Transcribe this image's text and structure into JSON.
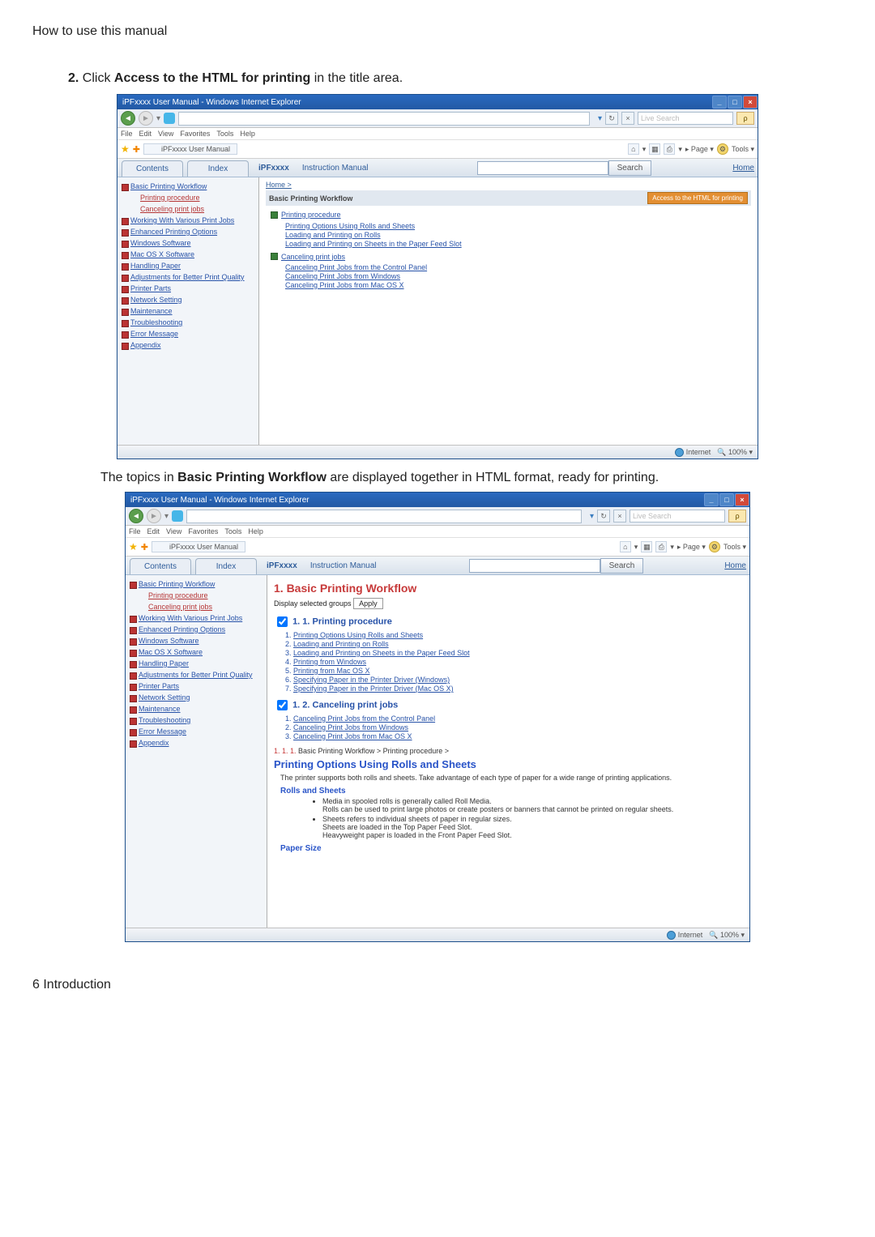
{
  "doc": {
    "breadcrumb_top": "How to use this manual",
    "step_num": "2.",
    "step_prefix": "Click ",
    "step_bold": "Access to the HTML for printing",
    "step_suffix": " in the title area.",
    "caption2_a": "The topics in ",
    "caption2_b": "Basic Printing Workflow",
    "caption2_c": " are displayed together in HTML format, ready for printing.",
    "footer": "6 Introduction"
  },
  "win": {
    "title": "iPFxxxx User Manual - Windows Internet Explorer",
    "search_placeholder": "Live Search",
    "menu": [
      "File",
      "Edit",
      "View",
      "Favorites",
      "Tools",
      "Help"
    ],
    "tab_label": "iPFxxxx User Manual",
    "tool_page": "Page",
    "tool_tools": "Tools"
  },
  "manual": {
    "tabs": {
      "contents": "Contents",
      "index": "Index"
    },
    "brand": "iPFxxxx",
    "doc_type": "Instruction Manual",
    "search_btn": "Search",
    "home": "Home",
    "nav": [
      {
        "t": "Basic Printing Workflow",
        "cls": "top"
      },
      {
        "t": "Printing procedure",
        "cls": "sub"
      },
      {
        "t": "Canceling print jobs",
        "cls": "sub"
      },
      {
        "t": "Working With Various Print Jobs",
        "cls": "top"
      },
      {
        "t": "Enhanced Printing Options",
        "cls": "top"
      },
      {
        "t": "Windows Software",
        "cls": "top"
      },
      {
        "t": "Mac OS X Software",
        "cls": "top"
      },
      {
        "t": "Handling Paper",
        "cls": "top"
      },
      {
        "t": "Adjustments for Better Print Quality",
        "cls": "top"
      },
      {
        "t": "Printer Parts",
        "cls": "top"
      },
      {
        "t": "Network Setting",
        "cls": "top"
      },
      {
        "t": "Maintenance",
        "cls": "top"
      },
      {
        "t": "Troubleshooting",
        "cls": "top"
      },
      {
        "t": "Error Message",
        "cls": "top"
      },
      {
        "t": "Appendix",
        "cls": "top"
      }
    ]
  },
  "content1": {
    "crumb": "Home >",
    "title": "Basic Printing Workflow",
    "access_btn": "Access to the HTML for printing",
    "g1": {
      "head": "Printing procedure",
      "items": [
        "Printing Options Using Rolls and Sheets",
        "Loading and Printing on Rolls",
        "Loading and Printing on Sheets in the Paper Feed Slot"
      ]
    },
    "g2": {
      "head": "Canceling print jobs",
      "items": [
        "Canceling Print Jobs from the Control Panel",
        "Canceling Print Jobs from Windows",
        "Canceling Print Jobs from Mac OS X"
      ]
    }
  },
  "content2": {
    "h1": "1. Basic Printing Workflow",
    "display_label": "Display selected groups",
    "apply": "Apply",
    "s1": {
      "head": "1. 1. Printing procedure",
      "items": [
        "Printing Options Using Rolls and Sheets",
        "Loading and Printing on Rolls",
        "Loading and Printing on Sheets in the Paper Feed Slot",
        "Printing from Windows",
        "Printing from Mac OS X",
        "Specifying Paper in the Printer Driver (Windows)",
        "Specifying Paper in the Printer Driver (Mac OS X)"
      ]
    },
    "s2": {
      "head": "1. 2. Canceling print jobs",
      "items": [
        "Canceling Print Jobs from the Control Panel",
        "Canceling Print Jobs from Windows",
        "Canceling Print Jobs from Mac OS X"
      ]
    },
    "toc_line_a": "1. 1. 1.",
    "toc_line_b": "Basic Printing Workflow > Printing procedure >",
    "topic_title": "Printing Options Using Rolls and Sheets",
    "para1": "The printer supports both rolls and sheets. Take advantage of each type of paper for a wide range of printing applications.",
    "rs_head": "Rolls and Sheets",
    "rs_b1a": "Media in spooled rolls is generally called Roll Media.",
    "rs_b1b": "Rolls can be used to print large photos or create posters or banners that cannot be printed on regular sheets.",
    "rs_b2a": "Sheets refers to individual sheets of paper in regular sizes.",
    "rs_b2b": "Sheets are loaded in the Top Paper Feed Slot.",
    "rs_b2c": "Heavyweight paper is loaded in the Front Paper Feed Slot.",
    "ps_head": "Paper Size"
  },
  "status": {
    "internet": "Internet",
    "zoom": "100%"
  }
}
